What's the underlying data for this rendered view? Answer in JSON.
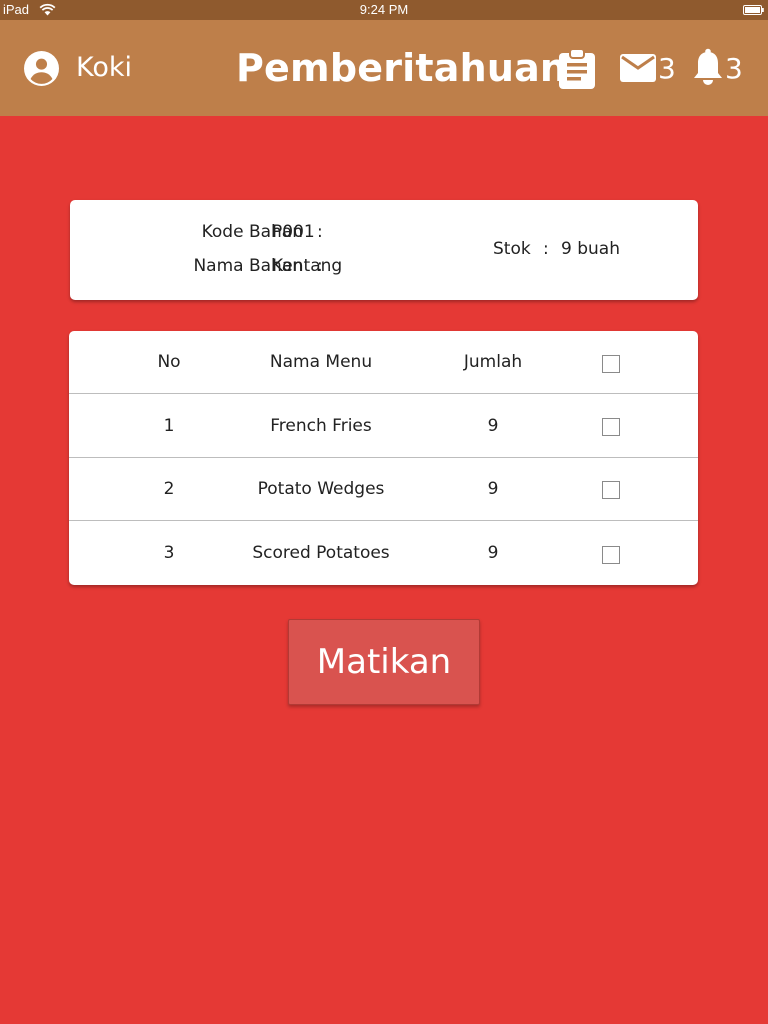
{
  "status_bar": {
    "carrier": "iPad",
    "time": "9:24 PM"
  },
  "header": {
    "user_name": "Koki",
    "title": "Pemberitahuan",
    "mail_count": "3",
    "notification_count": "3"
  },
  "ingredient": {
    "code_label": "Kode Bahan",
    "code_value": "P001",
    "name_label": "Nama Bahan",
    "name_value": "Kentang",
    "stock_label": "Stok",
    "stock_value": "9 buah",
    "separator": ":"
  },
  "table": {
    "headers": {
      "no": "No",
      "menu": "Nama Menu",
      "qty": "Jumlah"
    },
    "rows": [
      {
        "no": "1",
        "menu": "French Fries",
        "qty": "9",
        "checked": false
      },
      {
        "no": "2",
        "menu": "Potato Wedges",
        "qty": "9",
        "checked": false
      },
      {
        "no": "3",
        "menu": "Scored Potatoes",
        "qty": "9",
        "checked": false
      }
    ]
  },
  "actions": {
    "turn_off_label": "Matikan"
  },
  "colors": {
    "background": "#e53935",
    "header": "#be7f4a",
    "status_bar": "#8f5a2e",
    "button": "#d9534f"
  }
}
